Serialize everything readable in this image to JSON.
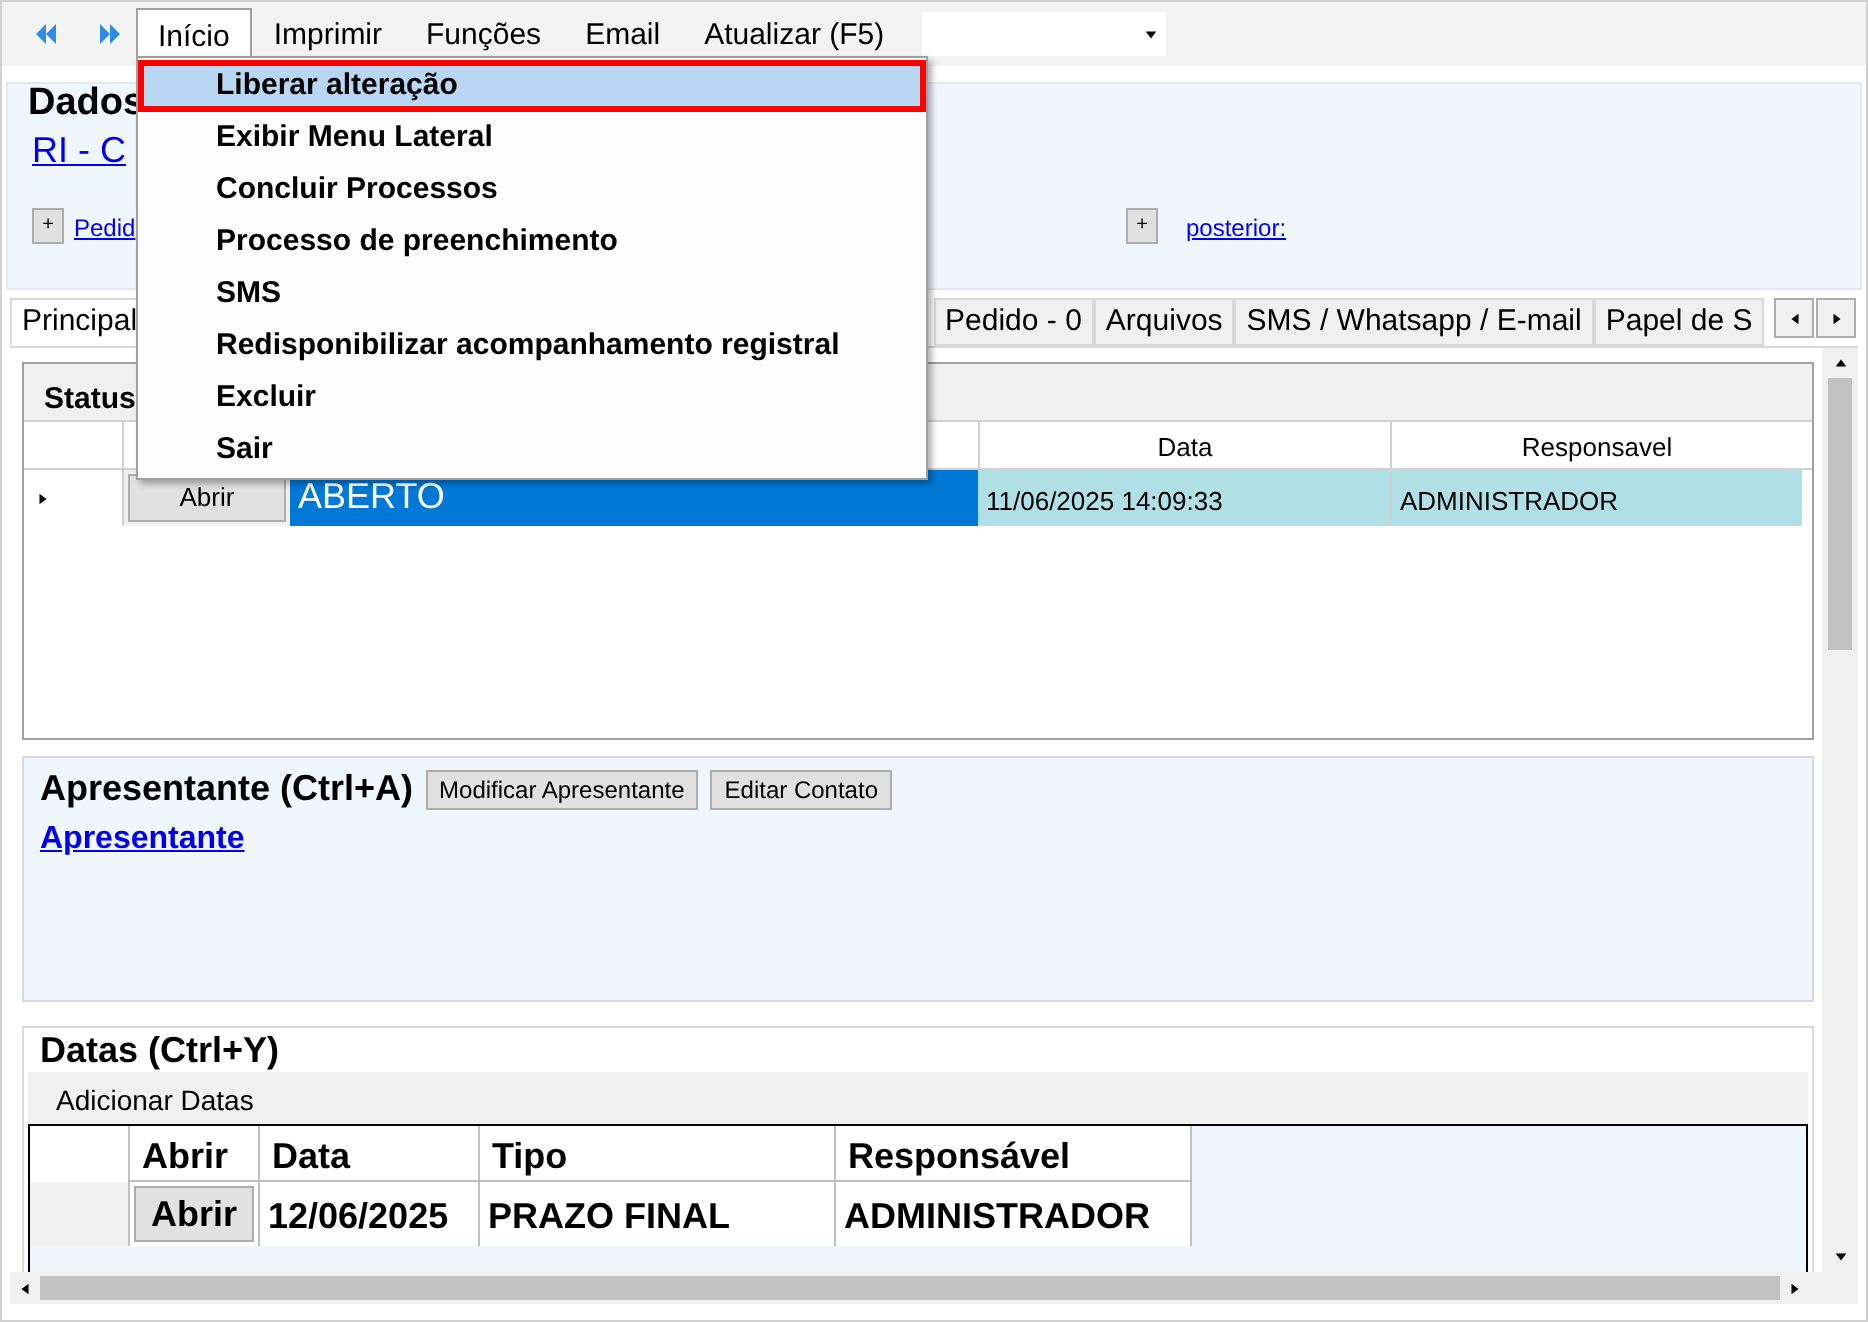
{
  "menubar": [
    {
      "label": "Início",
      "selected": true
    },
    {
      "label": "Imprimir",
      "selected": false
    },
    {
      "label": "Funções",
      "selected": false
    },
    {
      "label": "Email",
      "selected": false
    },
    {
      "label": "Atualizar (F5)",
      "selected": false
    }
  ],
  "menu": [
    {
      "label": "Liberar alteração",
      "selected": true
    },
    {
      "label": "Exibir Menu Lateral",
      "selected": false
    },
    {
      "label": "Concluir Processos",
      "selected": false
    },
    {
      "label": "Processo de preenchimento",
      "selected": false
    },
    {
      "label": "SMS",
      "selected": false
    },
    {
      "label": "Redisponibilizar acompanhamento registral",
      "selected": false
    },
    {
      "label": "Excluir",
      "selected": false
    },
    {
      "label": "Sair",
      "selected": false
    }
  ],
  "header": {
    "title": "Dados",
    "link": "RI - C",
    "expand": "+",
    "left_link": "Pedid",
    "right_link": "posterior:"
  },
  "tabs": [
    {
      "label": "Principal",
      "selected": true
    },
    {
      "label": "Pedido - 0",
      "selected": false
    },
    {
      "label": "Arquivos",
      "selected": false
    },
    {
      "label": "SMS / Whatsapp / E-mail",
      "selected": false
    },
    {
      "label": "Papel de S",
      "selected": false
    }
  ],
  "status": {
    "title": "Status",
    "columns": [
      "Data",
      "Responsavel"
    ],
    "rows": [
      {
        "button": "Abrir",
        "status": "ABERTO",
        "date": "11/06/2025 14:09:33",
        "user": "ADMINISTRADOR",
        "selected": true
      }
    ]
  },
  "apresentante": {
    "title": "Apresentante (Ctrl+A)",
    "buttons": [
      "Modificar Apresentante",
      "Editar Contato"
    ],
    "link": "Apresentante"
  },
  "datas": {
    "title": "Datas (Ctrl+Y)",
    "add": "Adicionar Datas",
    "columns": [
      "Abrir",
      "Data",
      "Tipo",
      "Responsável"
    ],
    "rows": [
      {
        "button": "Abrir",
        "date": "12/06/2025",
        "type": "PRAZO FINAL",
        "user": "ADMINISTRADOR"
      }
    ]
  }
}
